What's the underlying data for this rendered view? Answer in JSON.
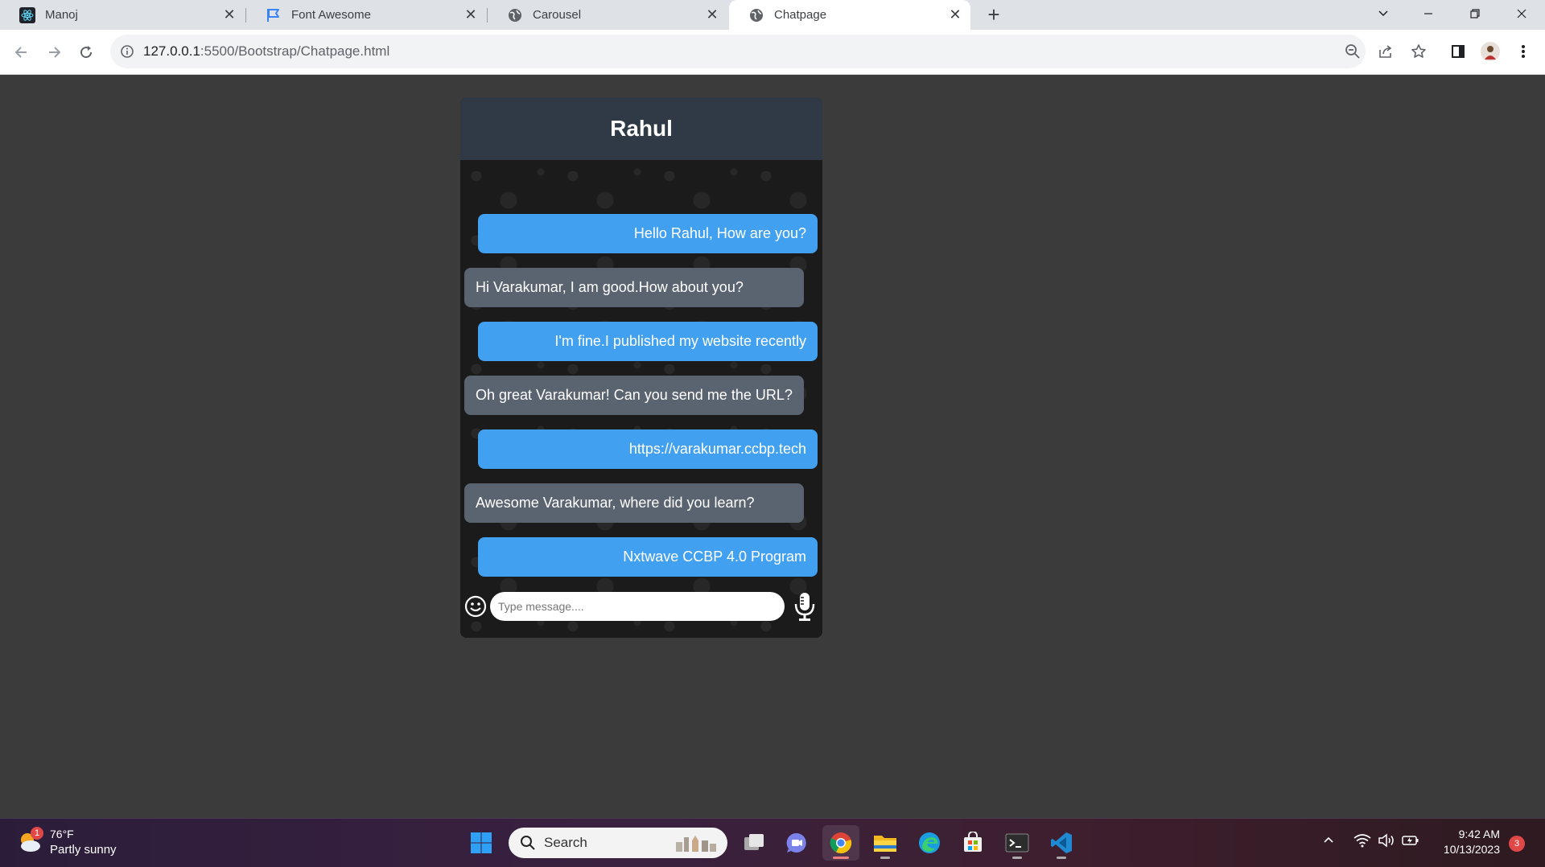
{
  "browser": {
    "tabs": [
      {
        "label": "Manoj",
        "icon": "react-icon"
      },
      {
        "label": "Font Awesome",
        "icon": "flag-icon"
      },
      {
        "label": "Carousel",
        "icon": "globe-icon"
      },
      {
        "label": "Chatpage",
        "icon": "globe-icon",
        "active": true
      }
    ],
    "url_host": "127.0.0.1",
    "url_path": ":5500/Bootstrap/Chatpage.html"
  },
  "chat": {
    "contact_name": "Rahul",
    "messages": [
      {
        "type": "sent",
        "text": "Hello Rahul, How are you?"
      },
      {
        "type": "received",
        "text": "Hi Varakumar, I am good.How about you?"
      },
      {
        "type": "sent",
        "text": "I'm fine.I published my website recently"
      },
      {
        "type": "received",
        "text": "Oh great Varakumar! Can you send me the URL?"
      },
      {
        "type": "sent",
        "text": "https://varakumar.ccbp.tech"
      },
      {
        "type": "received",
        "text": "Awesome Varakumar, where did you learn?"
      },
      {
        "type": "sent",
        "text": "Nxtwave CCBP 4.0 Program"
      }
    ],
    "input_placeholder": "Type message....",
    "colors": {
      "sent": "#42a0f0",
      "received": "#5a6470",
      "header": "#2f3a46"
    }
  },
  "taskbar": {
    "weather_temp": "76°F",
    "weather_desc": "Partly sunny",
    "weather_badge": "1",
    "search_label": "Search",
    "time": "9:42 AM",
    "date": "10/13/2023",
    "notification_count": "3"
  }
}
